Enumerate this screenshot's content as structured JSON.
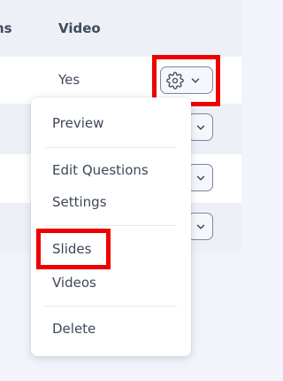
{
  "table": {
    "columns": [
      "ns",
      "Video"
    ],
    "rows": [
      {
        "video": "Yes"
      },
      {
        "video": ""
      },
      {
        "video": ""
      },
      {
        "video": ""
      }
    ]
  },
  "icons": {
    "settings": "gear-icon",
    "dropdown": "chevron-down-icon"
  },
  "menu": {
    "items": [
      "Preview",
      "Edit Questions",
      "Settings",
      "Slides",
      "Videos",
      "Delete"
    ]
  },
  "highlight_color": "#ee0000"
}
